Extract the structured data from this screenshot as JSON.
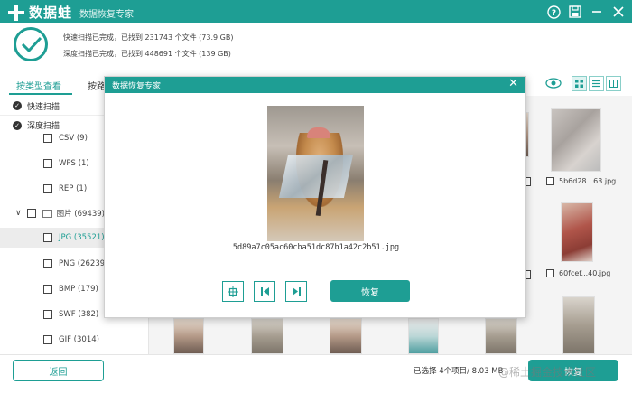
{
  "app": {
    "logo_text": "数据蛙",
    "subtitle": "数据恢复专家",
    "titlebar_buttons": [
      {
        "name": "help-icon",
        "glyph": "?"
      },
      {
        "name": "save-icon",
        "glyph": "▣"
      },
      {
        "name": "minimize-icon",
        "glyph": "—"
      },
      {
        "name": "close-icon",
        "glyph": "✕"
      }
    ]
  },
  "status": {
    "quick_scan": "快速扫描已完成，已找到 231743 个文件 (73.9 GB)",
    "deep_scan": "深度扫描已完成，已找到 448691 个文件 (139 GB)"
  },
  "tabs": [
    {
      "label": "按类型查看",
      "active": true
    },
    {
      "label": "按路",
      "active": false
    }
  ],
  "sidebar": {
    "quick_scan_label": "快速扫描",
    "deep_scan_label": "深度扫描",
    "categories": [
      {
        "label": "CSV (9)"
      },
      {
        "label": "WPS (1)"
      },
      {
        "label": "REP (1)"
      },
      {
        "label": "图片 (69439)",
        "expanded": true
      },
      {
        "label": "JPG (35521)",
        "selected": true
      },
      {
        "label": "PNG (26239)"
      },
      {
        "label": "BMP (179)"
      },
      {
        "label": "SWF (382)"
      },
      {
        "label": "GIF (3014)"
      }
    ]
  },
  "grid": {
    "files": [
      "5b6d28...63.jpg",
      "60fcef...40.jpg"
    ]
  },
  "bottom": {
    "back_label": "返回",
    "selection_info": "已选择 4个项目/ 8.03 MB",
    "recover_label": "恢复",
    "watermark": "@稀土掘金技术社区"
  },
  "modal": {
    "title": "数据恢复专家",
    "file_name": "5d89a7c05ac60cba51dc87b1a42c2b51.jpg",
    "recover_label": "恢复"
  },
  "colors": {
    "accent": "#1e9e94"
  }
}
